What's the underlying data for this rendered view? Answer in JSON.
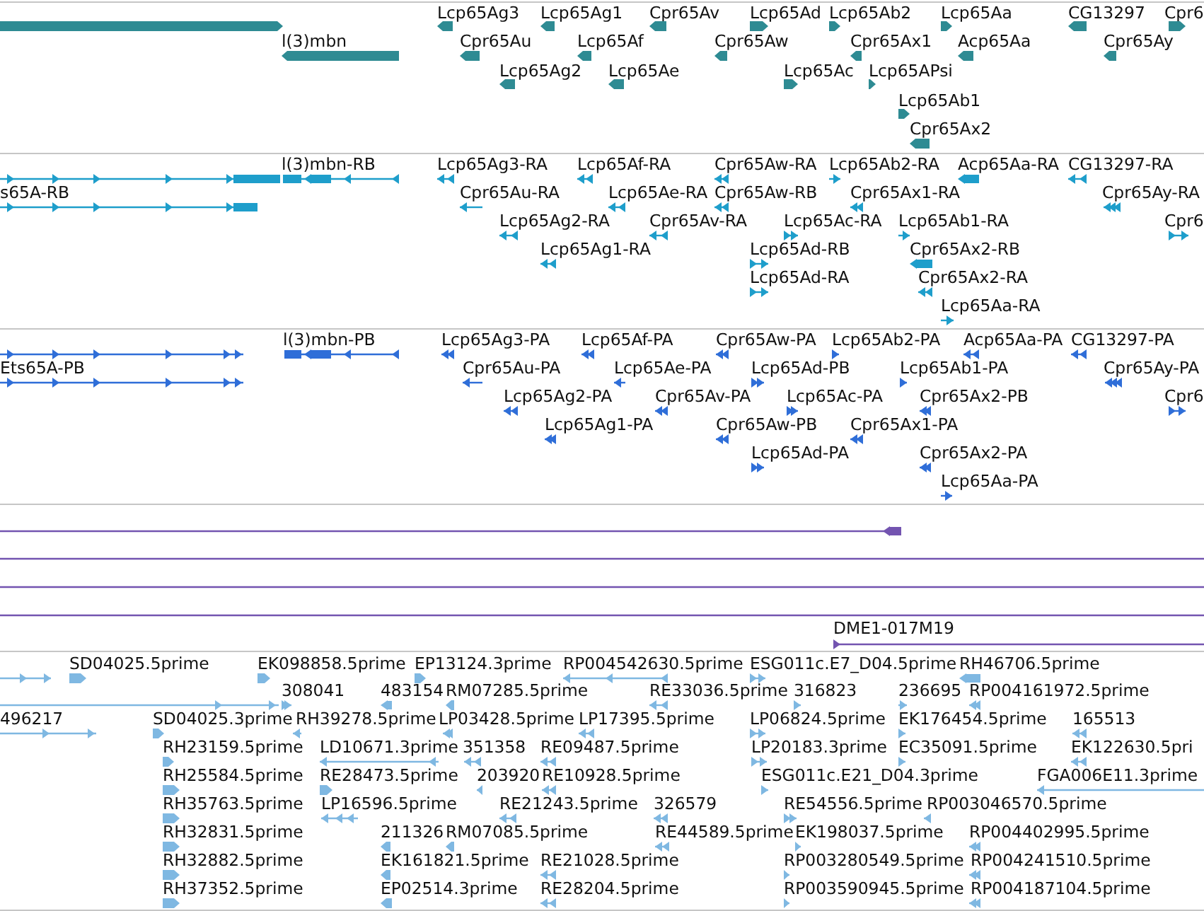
{
  "tracks": [
    {
      "color": "#2e8b93",
      "features": [
        {
          "forward": true
        },
        {
          "label": "Lcp65Ag3",
          "forward": false
        },
        {
          "label": "Lcp65Ag1",
          "forward": false
        },
        {
          "label": "Cpr65Av",
          "forward": false
        },
        {
          "label": "Lcp65Ad",
          "forward": true
        },
        {
          "label": "Lcp65Ab2",
          "forward": true
        },
        {
          "label": "Lcp65Aa",
          "forward": true
        },
        {
          "label": "CG13297",
          "forward": false
        },
        {
          "label": "Cpr6",
          "forward": true
        },
        {
          "label": "l(3)mbn",
          "forward": false
        },
        {
          "label": "Cpr65Au",
          "forward": false
        },
        {
          "label": "Lcp65Af",
          "forward": false
        },
        {
          "label": "Cpr65Aw",
          "forward": false
        },
        {
          "label": "Cpr65Ax1",
          "forward": false
        },
        {
          "label": "Acp65Aa",
          "forward": false
        },
        {
          "label": "Cpr65Ay",
          "forward": false
        },
        {
          "label": "Lcp65Ag2",
          "forward": false
        },
        {
          "label": "Lcp65Ae",
          "forward": false
        },
        {
          "label": "Lcp65Ac",
          "forward": true
        },
        {
          "label": "Lcp65APsi",
          "forward": true
        },
        {
          "label": "Lcp65Ab1",
          "forward": true
        },
        {
          "label": "Cpr65Ax2",
          "forward": false
        }
      ]
    },
    {
      "color": "#1e9ecb",
      "features": [
        {
          "forward": true
        },
        {
          "label": "l(3)mbn-RB",
          "forward": false
        },
        {
          "label": "Lcp65Ag3-RA",
          "forward": false
        },
        {
          "label": "Lcp65Af-RA",
          "forward": false
        },
        {
          "label": "Cpr65Aw-RA",
          "forward": false
        },
        {
          "label": "Lcp65Ab2-RA",
          "forward": true
        },
        {
          "label": "Acp65Aa-RA",
          "forward": false
        },
        {
          "label": "CG13297-RA",
          "forward": false
        },
        {
          "label": "s65A-RB",
          "forward": true
        },
        {
          "label": "Cpr65Au-RA",
          "forward": false
        },
        {
          "label": "Lcp65Ae-RA",
          "forward": false
        },
        {
          "label": "Cpr65Aw-RB",
          "forward": false
        },
        {
          "label": "Cpr65Ax1-RA",
          "forward": false
        },
        {
          "label": "Cpr65Ay-RA",
          "forward": false
        },
        {
          "label": "Lcp65Ag2-RA",
          "forward": false
        },
        {
          "label": "Cpr65Av-RA",
          "forward": false
        },
        {
          "label": "Lcp65Ac-RA",
          "forward": true
        },
        {
          "label": "Lcp65Ab1-RA",
          "forward": true
        },
        {
          "label": "Cpr6",
          "forward": true
        },
        {
          "label": "Lcp65Ag1-RA",
          "forward": false
        },
        {
          "label": "Lcp65Ad-RB",
          "forward": true
        },
        {
          "label": "Cpr65Ax2-RB",
          "forward": false
        },
        {
          "label": "Lcp65Ad-RA",
          "forward": true
        },
        {
          "label": "Cpr65Ax2-RA",
          "forward": false
        },
        {
          "label": "Lcp65Aa-RA",
          "forward": true
        }
      ]
    },
    {
      "color": "#2f6ed8",
      "features": [
        {
          "forward": true
        },
        {
          "label": "l(3)mbn-PB",
          "forward": false
        },
        {
          "label": "Lcp65Ag3-PA",
          "forward": false
        },
        {
          "label": "Lcp65Af-PA",
          "forward": false
        },
        {
          "label": "Cpr65Aw-PA",
          "forward": false
        },
        {
          "label": "Lcp65Ab2-PA",
          "forward": true
        },
        {
          "label": "Acp65Aa-PA",
          "forward": false
        },
        {
          "label": "CG13297-PA",
          "forward": false
        },
        {
          "label": "Ets65A-PB",
          "forward": true
        },
        {
          "label": "Cpr65Au-PA",
          "forward": false
        },
        {
          "label": "Lcp65Ae-PA",
          "forward": false
        },
        {
          "label": "Lcp65Ad-PB",
          "forward": true
        },
        {
          "label": "Lcp65Ab1-PA",
          "forward": true
        },
        {
          "label": "Cpr65Ay-PA",
          "forward": false
        },
        {
          "label": "Lcp65Ag2-PA",
          "forward": false
        },
        {
          "label": "Cpr65Av-PA",
          "forward": false
        },
        {
          "label": "Lcp65Ac-PA",
          "forward": true
        },
        {
          "label": "Cpr65Ax2-PB",
          "forward": false
        },
        {
          "label": "Cpr6",
          "forward": true
        },
        {
          "label": "Lcp65Ag1-PA",
          "forward": false
        },
        {
          "label": "Cpr65Aw-PB",
          "forward": false
        },
        {
          "label": "Cpr65Ax1-PA",
          "forward": false
        },
        {
          "label": "Lcp65Ad-PA",
          "forward": true
        },
        {
          "label": "Cpr65Ax2-PA",
          "forward": false
        },
        {
          "label": "Lcp65Aa-PA",
          "forward": true
        }
      ]
    },
    {
      "color": "#7354b0",
      "features": [
        {
          "kind": "gene",
          "forward": false
        },
        {
          "kind": "line"
        },
        {
          "kind": "line"
        },
        {
          "kind": "line"
        },
        {
          "kind": "line",
          "label": "DME1-017M19",
          "forward": true
        }
      ]
    },
    {
      "color": "#7fb8e2",
      "features": [
        {
          "forward": true
        },
        {
          "label": "SD04025.5prime",
          "forward": true
        },
        {
          "label": "EK098858.5prime",
          "forward": true
        },
        {
          "label": "EP13124.3prime",
          "forward": true
        },
        {
          "label": "RP004542630.5prime",
          "forward": false
        },
        {
          "label": "ESG011c.E7_D04.5prime",
          "forward": true
        },
        {
          "label": "RH46706.5prime",
          "forward": false
        },
        {
          "forward": true
        },
        {
          "label": "308041",
          "forward": true
        },
        {
          "label": "483154",
          "forward": false
        },
        {
          "label": "RM07285.5prime",
          "forward": false
        },
        {
          "label": "RE33036.5prime",
          "forward": false
        },
        {
          "label": "316823",
          "forward": true
        },
        {
          "label": "236695",
          "forward": true
        },
        {
          "label": "RP004161972.5prime",
          "forward": false
        },
        {
          "label": "496217",
          "forward": true
        },
        {
          "label": "SD04025.3prime",
          "forward": true
        },
        {
          "label": "RH39278.5prime",
          "forward": false
        },
        {
          "label": "LP03428.5prime",
          "forward": false
        },
        {
          "label": "LP17395.5prime",
          "forward": false
        },
        {
          "label": "LP06824.5prime",
          "forward": true
        },
        {
          "label": "EK176454.5prime",
          "forward": true
        },
        {
          "label": "165513",
          "forward": false
        },
        {
          "label": "RH23159.5prime",
          "forward": true
        },
        {
          "label": "LD10671.3prime",
          "forward": false
        },
        {
          "label": "351358",
          "forward": false
        },
        {
          "label": "RE09487.5prime",
          "forward": false
        },
        {
          "label": "LP20183.3prime",
          "forward": true
        },
        {
          "label": "EC35091.5prime",
          "forward": true
        },
        {
          "label": "EK122630.5pri",
          "forward": false
        },
        {
          "label": "RH25584.5prime",
          "forward": true
        },
        {
          "label": "RE28473.5prime",
          "forward": true
        },
        {
          "label": "203920",
          "forward": false
        },
        {
          "label": "RE10928.5prime",
          "forward": false
        },
        {
          "label": "ESG011c.E21_D04.3prime",
          "forward": true
        },
        {
          "label": "FGA006E11.3prime",
          "forward": false
        },
        {
          "label": "RH35763.5prime",
          "forward": true
        },
        {
          "label": "LP16596.5prime",
          "forward": false
        },
        {
          "label": "RE21243.5prime",
          "forward": false
        },
        {
          "label": "326579",
          "forward": false
        },
        {
          "label": "RE54556.5prime",
          "forward": true
        },
        {
          "label": "RP003046570.5prime",
          "forward": false
        },
        {
          "label": "RH32831.5prime",
          "forward": true
        },
        {
          "label": "211326",
          "forward": false
        },
        {
          "label": "RM07085.5prime",
          "forward": false
        },
        {
          "label": "RE44589.5prime",
          "forward": false
        },
        {
          "label": "EK198037.5prime",
          "forward": true
        },
        {
          "label": "RP004402995.5prime",
          "forward": false
        },
        {
          "label": "RH32882.5prime",
          "forward": true
        },
        {
          "label": "EK161821.5prime",
          "forward": false
        },
        {
          "label": "RE21028.5prime",
          "forward": false
        },
        {
          "label": "RP003280549.5prime",
          "forward": true
        },
        {
          "label": "RP004241510.5prime",
          "forward": false
        },
        {
          "label": "RH37352.5prime",
          "forward": true
        },
        {
          "label": "EP02514.3prime",
          "forward": false
        },
        {
          "label": "RE28204.5prime",
          "forward": false
        },
        {
          "label": "RP003590945.5prime",
          "forward": true
        },
        {
          "label": "RP004187104.5prime",
          "forward": false
        }
      ]
    }
  ]
}
